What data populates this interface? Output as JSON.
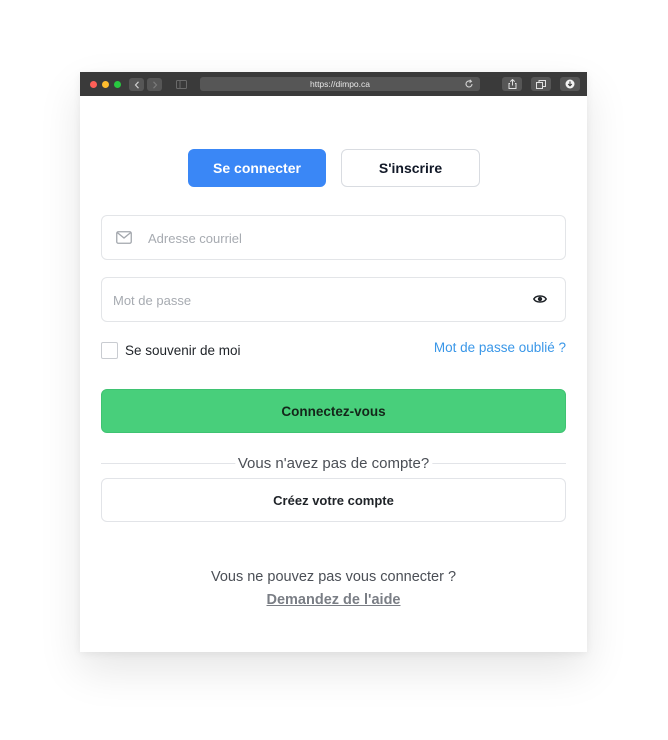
{
  "browser": {
    "url": "https://dimpo.ca"
  },
  "tabs": {
    "login_label": "Se connecter",
    "signup_label": "S'inscrire"
  },
  "form": {
    "email_placeholder": "Adresse courriel",
    "email_value": "",
    "password_placeholder": "Mot de passe",
    "password_value": "",
    "remember_label": "Se souvenir de moi",
    "forgot_label": "Mot de passe oublié ?",
    "submit_label": "Connectez-vous"
  },
  "signup": {
    "prompt": "Vous n'avez pas de compte?",
    "create_label": "Créez votre compte"
  },
  "help": {
    "text": "Vous ne pouvez pas vous connecter ?",
    "link_label": "Demandez de l'aide"
  },
  "colors": {
    "primary": "#3a87f6",
    "success": "#48cf7b",
    "link": "#3a97e8"
  },
  "icons": {
    "email": "mail-icon",
    "password": "eye-icon"
  }
}
